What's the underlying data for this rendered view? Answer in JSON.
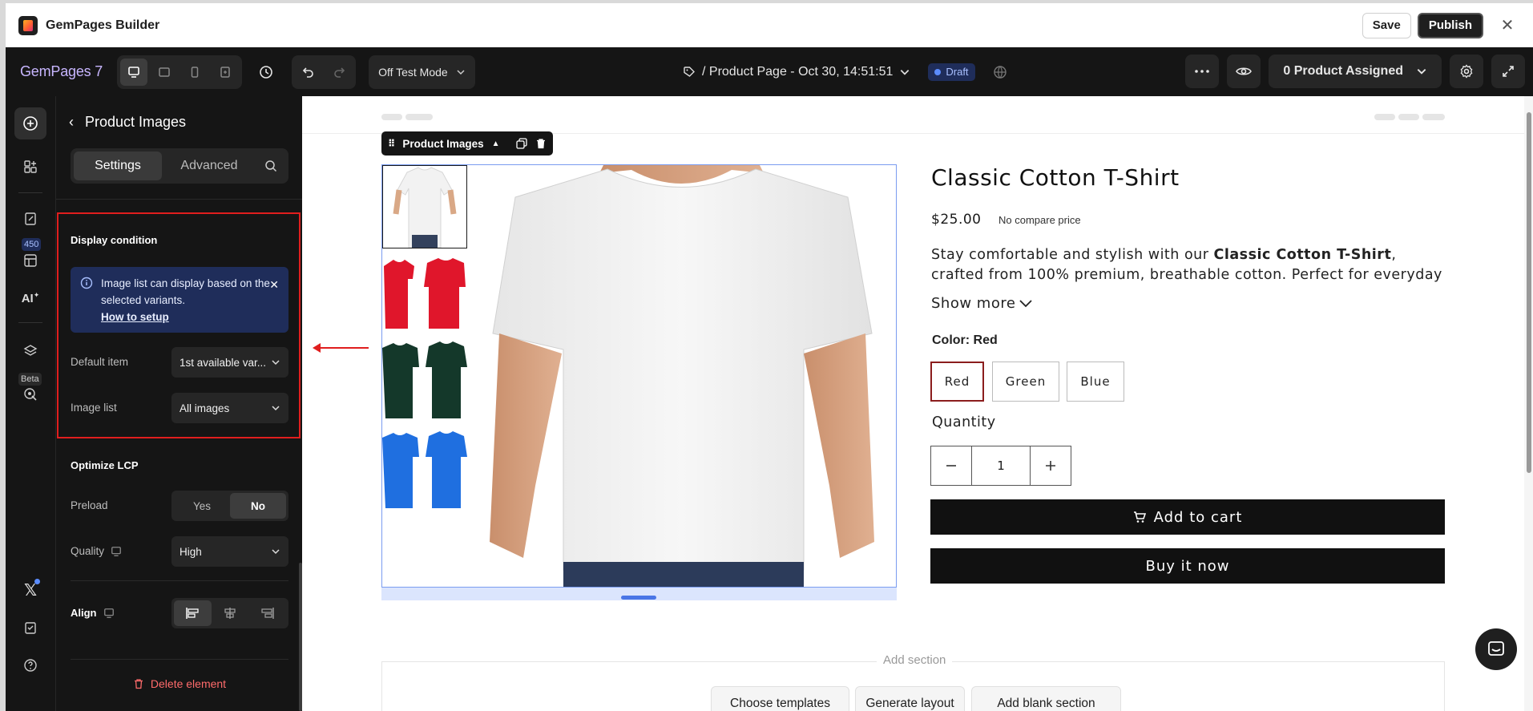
{
  "app": {
    "title": "GemPages Builder",
    "save_label": "Save",
    "publish_label": "Publish"
  },
  "toolbar": {
    "brand": "GemPages 7",
    "test_mode": "Off Test Mode",
    "page_title": "/ Product Page - Oct 30, 14:51:51",
    "status": "Draft",
    "assigned": "0 Product Assigned"
  },
  "rail": {
    "badge": "450",
    "beta": "Beta",
    "ai": "AI"
  },
  "panel": {
    "title": "Product Images",
    "tabs": {
      "settings": "Settings",
      "advanced": "Advanced"
    },
    "display_condition": {
      "title": "Display condition",
      "info_text": "Image list can display based on the selected variants.",
      "info_link": "How to setup",
      "default_item_label": "Default item",
      "default_item_value": "1st available var...",
      "image_list_label": "Image list",
      "image_list_value": "All images"
    },
    "optimize": {
      "title": "Optimize LCP",
      "preload_label": "Preload",
      "preload_yes": "Yes",
      "preload_no": "No",
      "preload_selected": "No",
      "quality_label": "Quality",
      "quality_value": "High"
    },
    "align_label": "Align",
    "delete_label": "Delete element"
  },
  "canvas": {
    "element_tag": "Product Images",
    "product": {
      "title": "Classic Cotton T-Shirt",
      "price": "$25.00",
      "compare": "No compare price",
      "desc_before": "Stay comfortable and stylish with our ",
      "desc_bold": "Classic Cotton T-Shirt",
      "desc_after": ", crafted from 100% premium, breathable cotton. Perfect for everyday",
      "show_more": "Show more",
      "color_label": "Color: Red",
      "colors": [
        "Red",
        "Green",
        "Blue"
      ],
      "selected_color": "Red",
      "quantity_label": "Quantity",
      "quantity": "1",
      "add_to_cart": "Add to cart",
      "buy_now": "Buy it now"
    },
    "add_section": {
      "label": "Add section",
      "buttons": [
        "Choose templates",
        "Generate layout",
        "Add blank section"
      ]
    }
  },
  "colors": {
    "accent": "#5b8cff",
    "highlight": "#e01e1e",
    "dark": "#151515"
  }
}
